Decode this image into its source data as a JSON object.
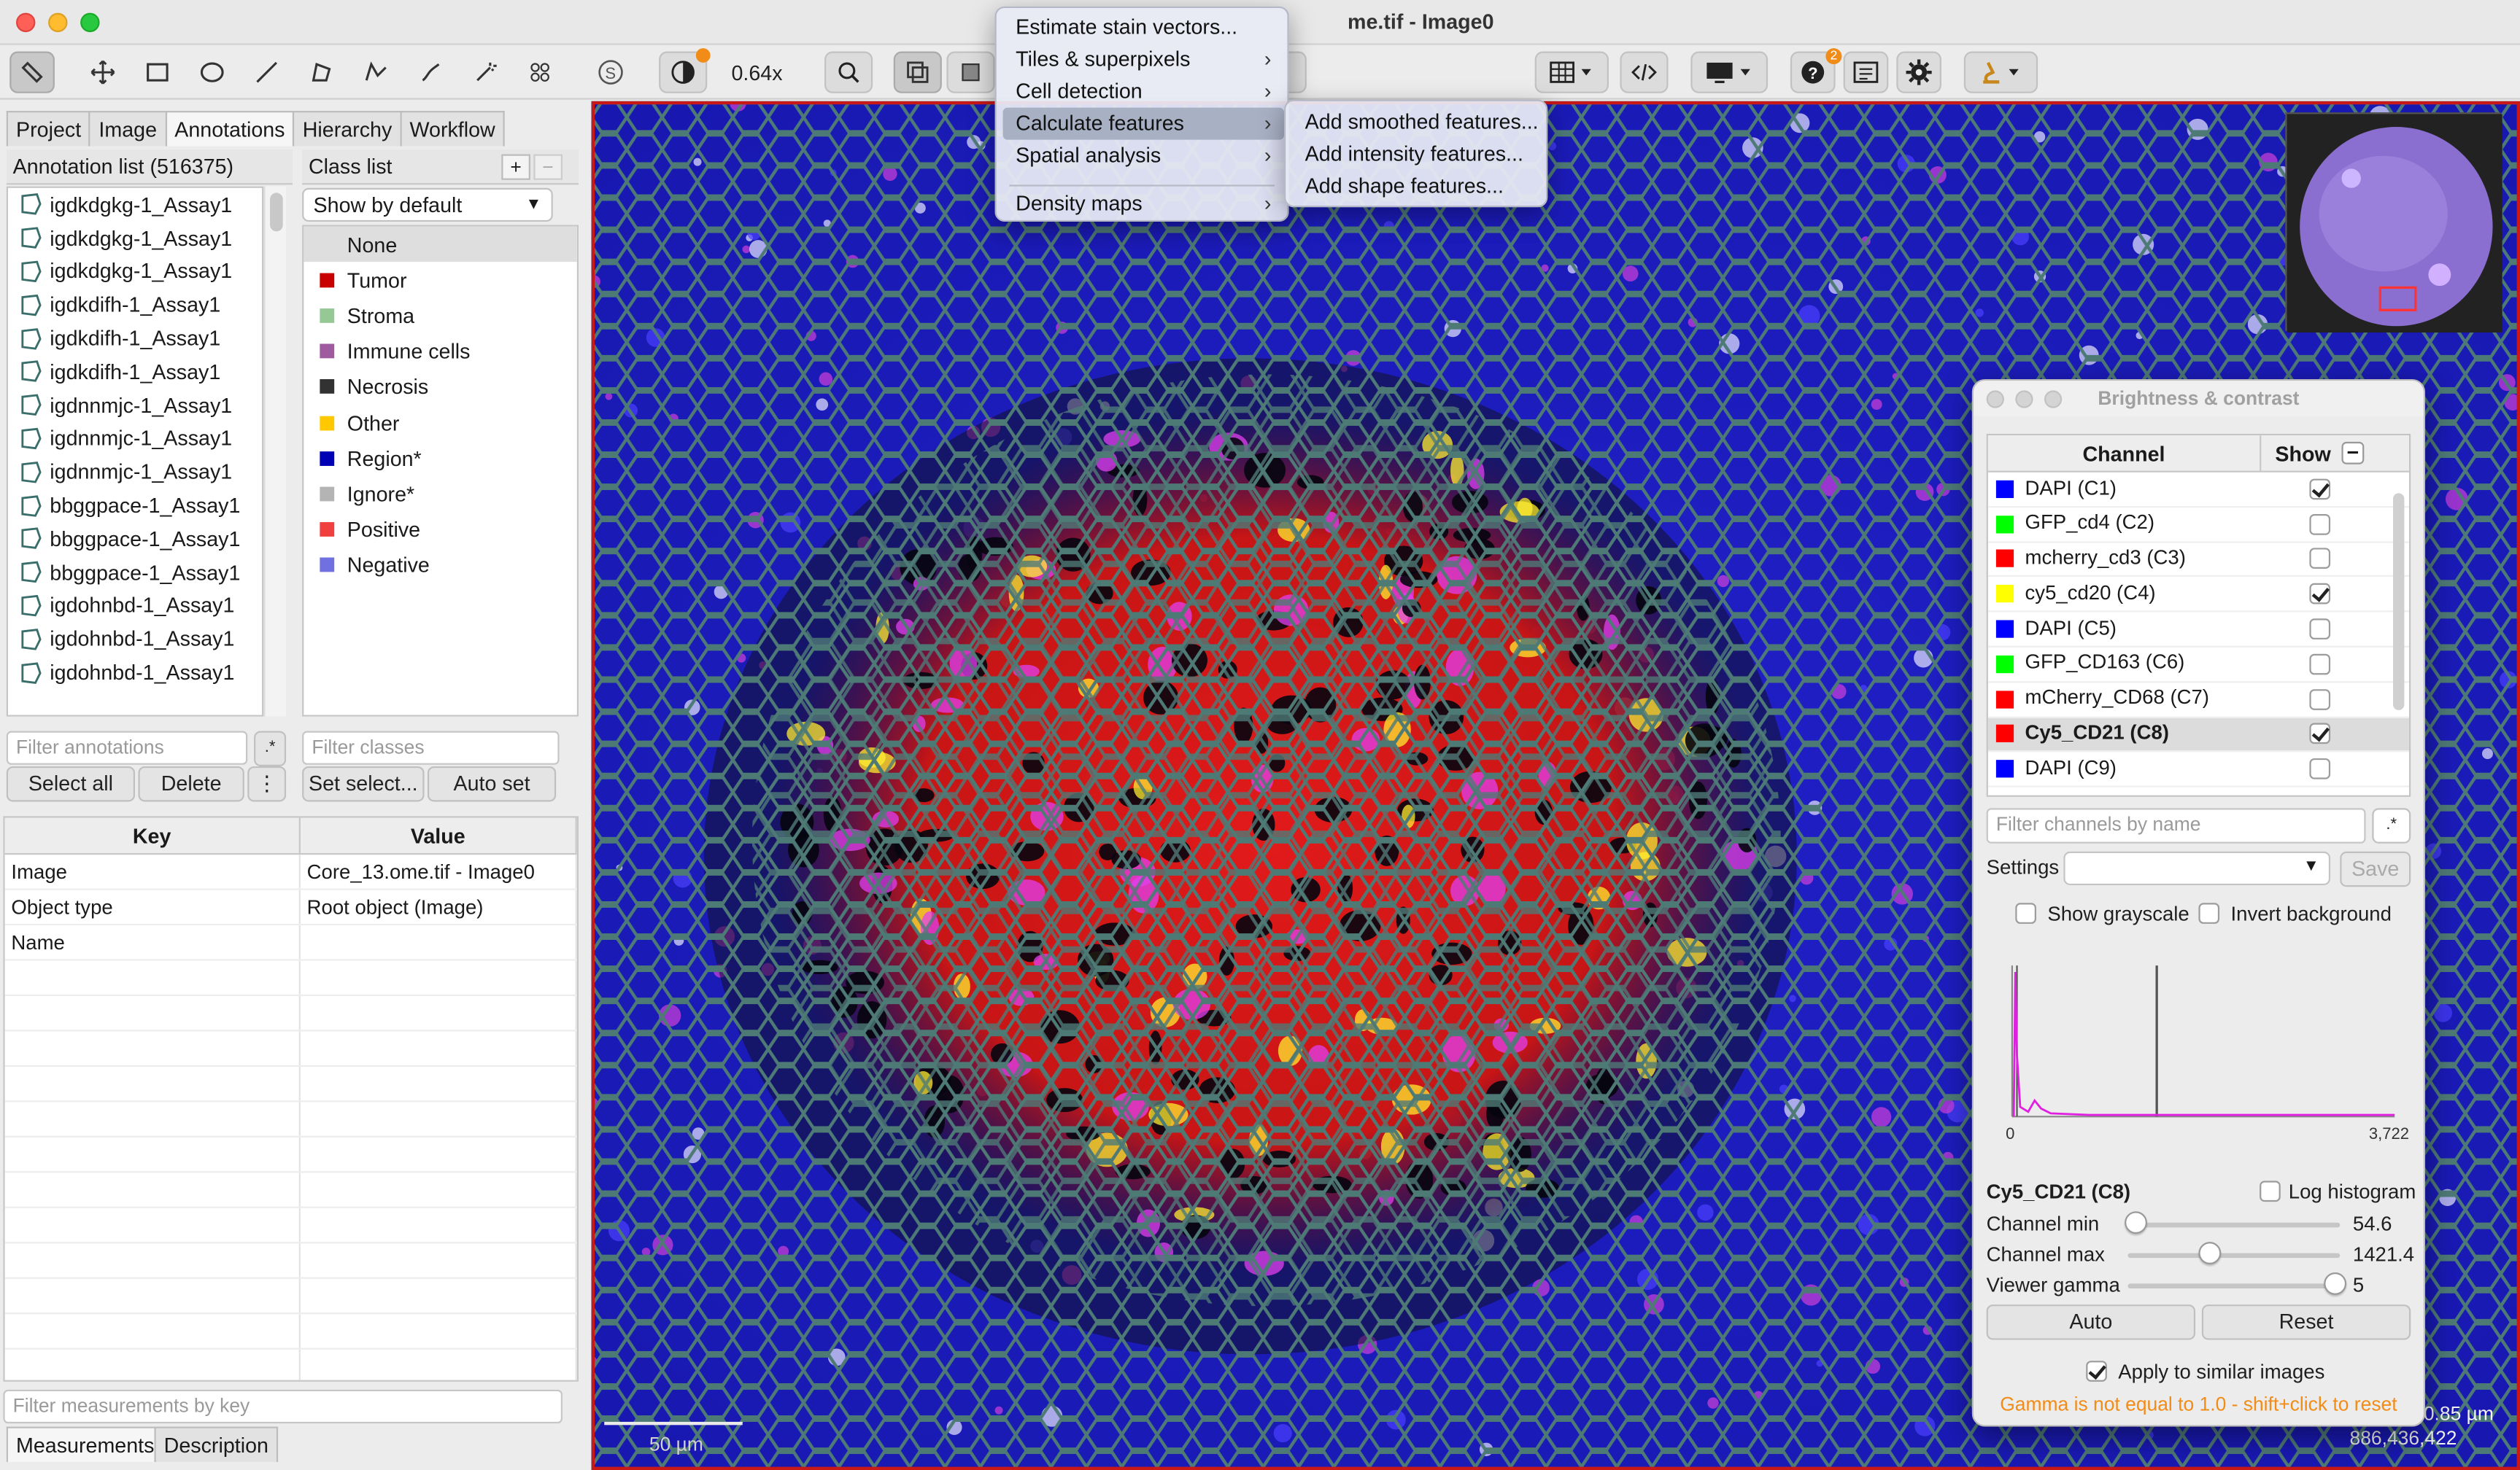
{
  "window": {
    "title": "me.tif - Image0"
  },
  "toolbar": {
    "zoom": "0.64x",
    "notification_count": "2"
  },
  "tabs": [
    "Project",
    "Image",
    "Annotations",
    "Hierarchy",
    "Workflow"
  ],
  "annotations": {
    "header": "Annotation list (516375)",
    "items": [
      "igdkdgkg-1_Assay1",
      "igdkdgkg-1_Assay1",
      "igdkdgkg-1_Assay1",
      "igdkdifh-1_Assay1",
      "igdkdifh-1_Assay1",
      "igdkdifh-1_Assay1",
      "igdnnmjc-1_Assay1",
      "igdnnmjc-1_Assay1",
      "igdnnmjc-1_Assay1",
      "bbggpace-1_Assay1",
      "bbggpace-1_Assay1",
      "bbggpace-1_Assay1",
      "igdohnbd-1_Assay1",
      "igdohnbd-1_Assay1",
      "igdohnbd-1_Assay1"
    ],
    "filter_placeholder": "Filter annotations",
    "select_all": "Select all",
    "delete": "Delete"
  },
  "classes": {
    "header": "Class list",
    "dropdown": "Show by default",
    "items": [
      {
        "name": "None",
        "color": ""
      },
      {
        "name": "Tumor",
        "color": "#c80000"
      },
      {
        "name": "Stroma",
        "color": "#96c896"
      },
      {
        "name": "Immune cells",
        "color": "#a05aa0"
      },
      {
        "name": "Necrosis",
        "color": "#323232"
      },
      {
        "name": "Other",
        "color": "#ffc800"
      },
      {
        "name": "Region*",
        "color": "#0000b4"
      },
      {
        "name": "Ignore*",
        "color": "#b4b4b4"
      },
      {
        "name": "Positive",
        "color": "#f04040"
      },
      {
        "name": "Negative",
        "color": "#7070e0"
      }
    ],
    "filter_placeholder": "Filter classes",
    "set_select": "Set select...",
    "auto_set": "Auto set"
  },
  "properties": {
    "key_header": "Key",
    "value_header": "Value",
    "rows": [
      {
        "key": "Image",
        "value": "Core_13.ome.tif - Image0"
      },
      {
        "key": "Object type",
        "value": "Root object (Image)"
      },
      {
        "key": "Name",
        "value": ""
      }
    ],
    "filter_placeholder": "Filter measurements by key",
    "tab_measurements": "Measurements",
    "tab_description": "Description"
  },
  "menu": {
    "items": [
      "Estimate stain vectors...",
      "Tiles & superpixels",
      "Cell detection",
      "Calculate features",
      "Spatial analysis",
      "Density maps"
    ],
    "submenu": [
      "Add smoothed features...",
      "Add intensity features...",
      "Add shape features..."
    ]
  },
  "viewer": {
    "scale_label": "50 µm",
    "pixel_size": "0.85 µm",
    "pixel_value": "886,436,422"
  },
  "brightness": {
    "title": "Brightness & contrast",
    "col_channel": "Channel",
    "col_show": "Show",
    "channels": [
      {
        "name": "DAPI (C1)",
        "color": "#0000ff",
        "show": true
      },
      {
        "name": "GFP_cd4 (C2)",
        "color": "#00ff00",
        "show": false
      },
      {
        "name": "mcherry_cd3 (C3)",
        "color": "#ff0000",
        "show": false
      },
      {
        "name": "cy5_cd20 (C4)",
        "color": "#ffff00",
        "show": true
      },
      {
        "name": "DAPI (C5)",
        "color": "#0000ff",
        "show": false
      },
      {
        "name": "GFP_CD163 (C6)",
        "color": "#00ff00",
        "show": false
      },
      {
        "name": "mCherry_CD68 (C7)",
        "color": "#ff0000",
        "show": false
      },
      {
        "name": "Cy5_CD21 (C8)",
        "color": "#ff0000",
        "show": true
      },
      {
        "name": "DAPI (C9)",
        "color": "#0000ff",
        "show": false
      }
    ],
    "filter_placeholder": "Filter channels by name",
    "settings_label": "Settings",
    "save": "Save",
    "show_grayscale": "Show grayscale",
    "invert_background": "Invert background",
    "hist_min_label": "0",
    "hist_max_label": "3,722",
    "selected_channel": "Cy5_CD21 (C8)",
    "log_histogram": "Log histogram",
    "channel_min_label": "Channel min",
    "channel_min_value": "54.6",
    "channel_max_label": "Channel max",
    "channel_max_value": "1421.4",
    "gamma_label": "Viewer gamma",
    "gamma_value": "5",
    "auto": "Auto",
    "reset": "Reset",
    "apply_similar": "Apply to similar images",
    "warning": "Gamma is not equal to 1.0 - shift+click to reset"
  }
}
